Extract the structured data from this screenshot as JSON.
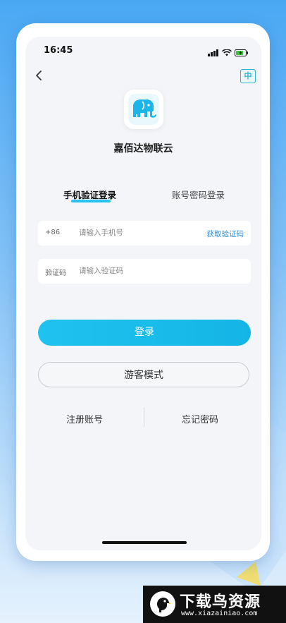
{
  "status_bar": {
    "time": "16:45",
    "icons": [
      "signal-icon",
      "wifi-icon",
      "battery-charging-icon"
    ]
  },
  "header": {
    "back_icon": "chevron-left-icon",
    "language_toggle": "中"
  },
  "app": {
    "name": "嘉佰达物联云",
    "logo_icon": "elephant-icon"
  },
  "tabs": [
    {
      "label": "手机验证登录",
      "active": true
    },
    {
      "label": "账号密码登录",
      "active": false
    }
  ],
  "form": {
    "phone": {
      "prefix": "+86",
      "placeholder": "请输入手机号",
      "value": "",
      "get_code_label": "获取验证码"
    },
    "code": {
      "label": "验证码",
      "placeholder": "请输入验证码",
      "value": ""
    }
  },
  "buttons": {
    "login": "登录",
    "guest": "游客模式"
  },
  "links": {
    "register": "注册账号",
    "forgot": "忘记密码"
  },
  "watermark": {
    "title": "下载鸟资源",
    "url": "www.xiazainiao.com"
  },
  "colors": {
    "accent": "#1fc3ee",
    "link": "#2e8fd8",
    "background": "#f3f5f8"
  }
}
